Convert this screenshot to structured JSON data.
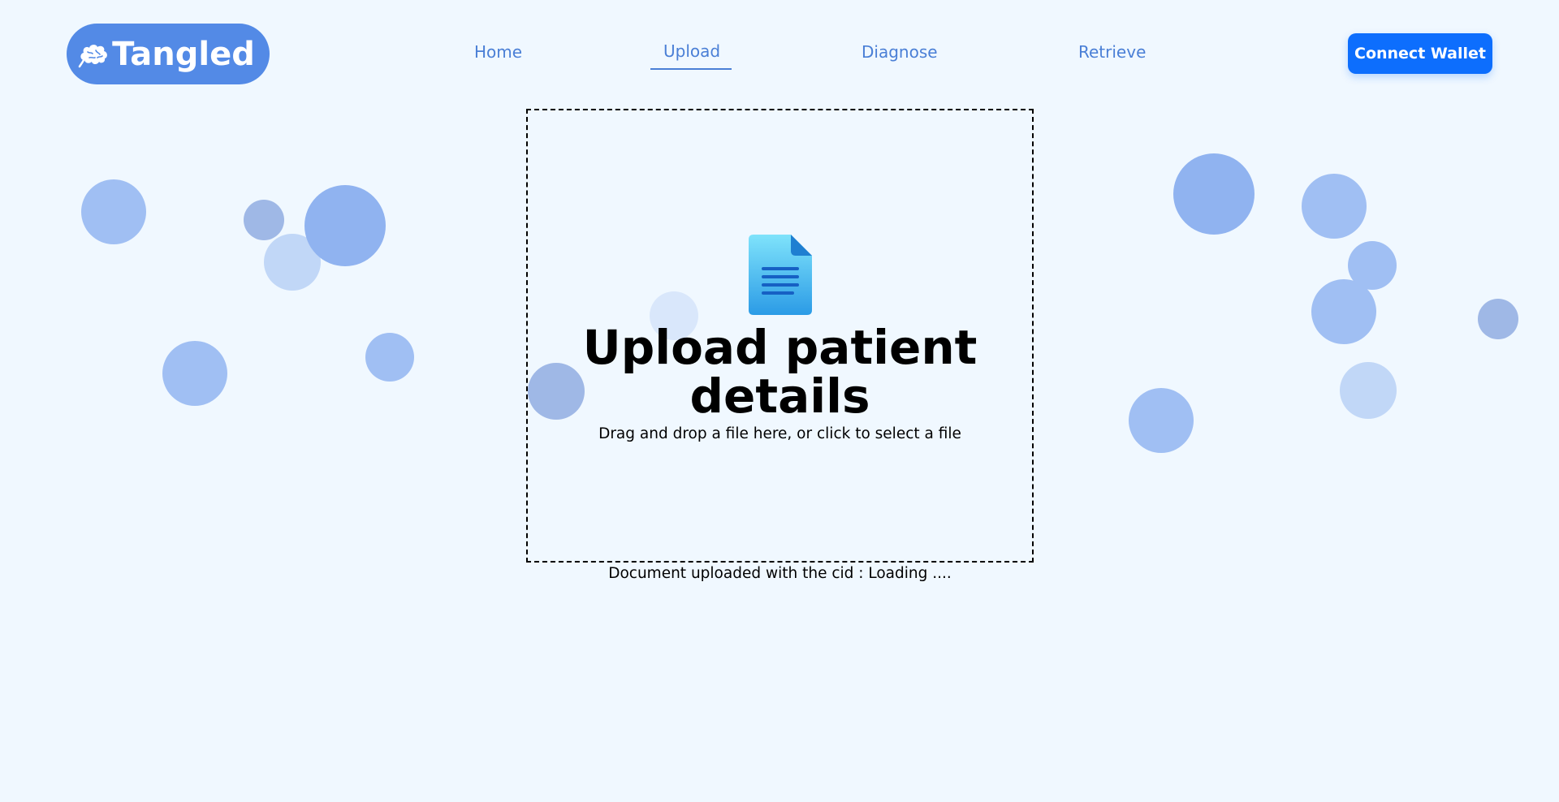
{
  "header": {
    "logo_text": "Tangled",
    "logo_icon": "brain-icon",
    "nav": [
      {
        "label": "Home",
        "active": false
      },
      {
        "label": "Upload",
        "active": true
      },
      {
        "label": "Diagnose",
        "active": false
      },
      {
        "label": "Retrieve",
        "active": false
      }
    ],
    "connect_label": "Connect Wallet"
  },
  "upload": {
    "icon": "document-icon",
    "title": "Upload patient details",
    "subtitle": "Drag and drop a file here, or click to select a file",
    "status": "Document uploaded with the cid : Loading ...."
  },
  "colors": {
    "background": "#f0f8ff",
    "logo_bg": "#538ae6",
    "nav_text": "#4a7fd6",
    "button_bg": "#0d6efd",
    "bubble": "#a0bff3"
  }
}
